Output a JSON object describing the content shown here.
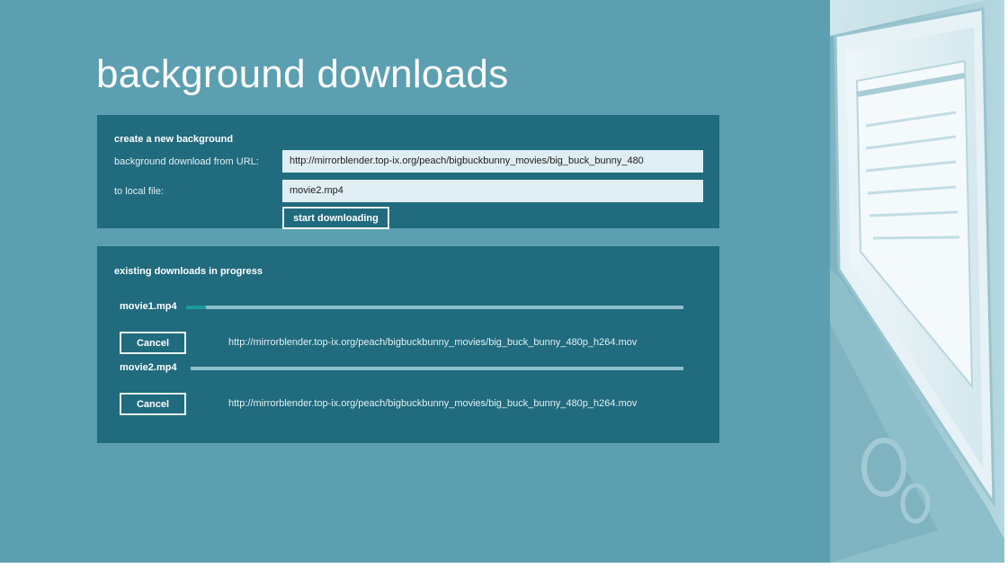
{
  "page": {
    "title": "background downloads"
  },
  "create_panel": {
    "heading": "create a new background",
    "url_label": "background download from URL:",
    "url_value": "http://mirrorblender.top-ix.org/peach/bigbuckbunny_movies/big_buck_bunny_480",
    "file_label": "to local file:",
    "file_value": "movie2.mp4",
    "start_button_label": "start downloading"
  },
  "progress_panel": {
    "heading": "existing downloads in progress",
    "downloads": [
      {
        "name": "movie1.mp4",
        "progress": 0.04,
        "cancel_label": "Cancel",
        "url": "http://mirrorblender.top-ix.org/peach/bigbuckbunny_movies/big_buck_bunny_480p_h264.mov"
      },
      {
        "name": "movie2.mp4",
        "progress": 0.0,
        "cancel_label": "Cancel",
        "url": "http://mirrorblender.top-ix.org/peach/bigbuckbunny_movies/big_buck_bunny_480p_h264.mov"
      }
    ]
  },
  "colors": {
    "background": "#5b9fb1",
    "panel": "#206b7e",
    "field": "#dfeef2",
    "progress_track": "#8ec0cc",
    "progress_fill": "#1a9c9a"
  }
}
